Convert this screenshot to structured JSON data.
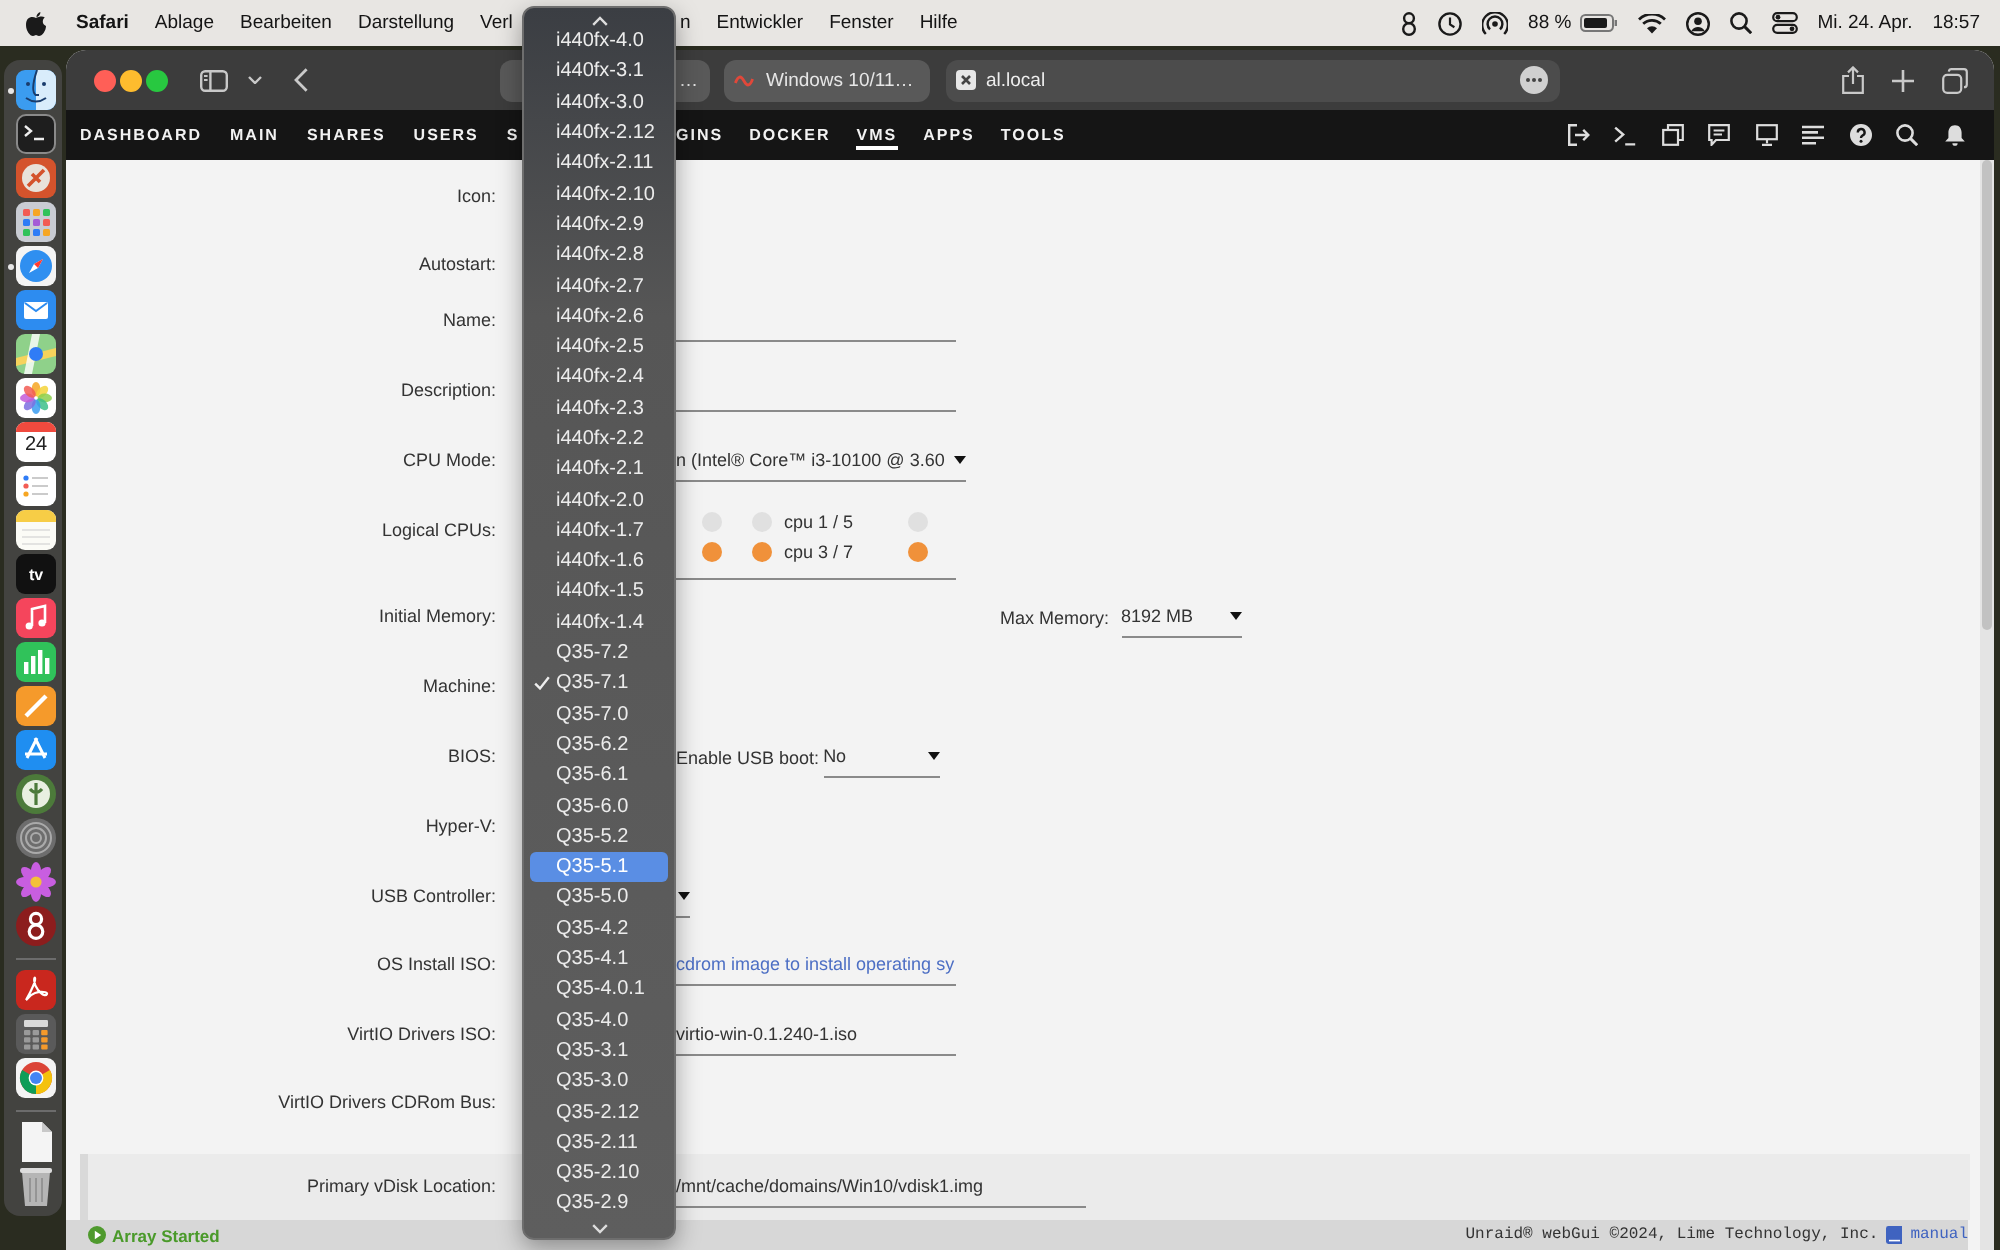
{
  "menu_bar": {
    "app_name": "Safari",
    "menus": [
      "Ablage",
      "Bearbeiten",
      "Darstellung",
      "Verl",
      "n",
      "Entwickler",
      "Fenster",
      "Hilfe"
    ],
    "battery_percent": "88 %",
    "date": "Mi. 24. Apr.",
    "time": "18:57"
  },
  "dock": {
    "items": [
      {
        "kind": "finder",
        "running": true
      },
      {
        "kind": "terminal",
        "running": false
      },
      {
        "kind": "disc",
        "running": false
      },
      {
        "kind": "launchpad",
        "running": false
      },
      {
        "kind": "safari",
        "running": true
      },
      {
        "kind": "mail",
        "running": false
      },
      {
        "kind": "maps",
        "running": false
      },
      {
        "kind": "photos",
        "running": false
      },
      {
        "kind": "calendar",
        "label": "24",
        "running": false
      },
      {
        "kind": "reminders",
        "running": false
      },
      {
        "kind": "notes",
        "running": false
      },
      {
        "kind": "tv",
        "label": "tv",
        "running": false
      },
      {
        "kind": "music",
        "running": false
      },
      {
        "kind": "numbers",
        "running": false
      },
      {
        "kind": "pen",
        "running": false
      },
      {
        "kind": "store",
        "running": false
      },
      {
        "kind": "leaf",
        "running": false
      },
      {
        "kind": "spiral",
        "running": false
      },
      {
        "kind": "daisy",
        "running": false
      },
      {
        "kind": "eight",
        "running": false
      },
      {
        "kind": "separator"
      },
      {
        "kind": "pdf",
        "running": false
      },
      {
        "kind": "calculator",
        "running": false
      },
      {
        "kind": "chrome",
        "running": false
      },
      {
        "kind": "separator"
      },
      {
        "kind": "document",
        "running": false
      },
      {
        "kind": "trash",
        "running": false
      }
    ]
  },
  "browser": {
    "tabs": [
      {
        "title": "…",
        "selected": false
      },
      {
        "title": "Windows 10/11…",
        "selected": false
      }
    ],
    "address": "al.local"
  },
  "nav": {
    "items": [
      {
        "label": "DASHBOARD",
        "selected": false
      },
      {
        "label": "MAIN",
        "selected": false
      },
      {
        "label": "SHARES",
        "selected": false
      },
      {
        "label": "USERS",
        "selected": false
      },
      {
        "label": "S",
        "selected": false
      },
      {
        "label": "GINS",
        "selected": false
      },
      {
        "label": "DOCKER",
        "selected": false
      },
      {
        "label": "VMS",
        "selected": true
      },
      {
        "label": "APPS",
        "selected": false
      },
      {
        "label": "TOOLS",
        "selected": false
      }
    ]
  },
  "form": {
    "rows": [
      {
        "label": "Icon:",
        "kind": "blank"
      },
      {
        "label": "Autostart:",
        "kind": "blank"
      },
      {
        "label": "Name:",
        "kind": "input"
      },
      {
        "label": "Description:",
        "kind": "input"
      },
      {
        "label": "CPU Mode:",
        "kind": "select",
        "value": "n (Intel® Core™ i3-10100 @ 3.60"
      },
      {
        "label": "Logical CPUs:",
        "kind": "cpus",
        "cpu_rows": [
          {
            "pins": [
              {
                "checked": false
              },
              {
                "checked": false,
                "label": "cpu 1 / 5"
              },
              {
                "checked": false
              }
            ]
          },
          {
            "pins": [
              {
                "checked": true
              },
              {
                "checked": true,
                "label": "cpu 3 / 7"
              },
              {
                "checked": true
              }
            ]
          }
        ]
      },
      {
        "label": "Initial Memory:",
        "kind": "memory",
        "side_field": {
          "label": "Max Memory:",
          "value": "8192 MB"
        }
      },
      {
        "label": "Machine:",
        "kind": "blank"
      },
      {
        "label": "BIOS:",
        "kind": "bios",
        "side_field": {
          "label": "Enable USB boot:",
          "value": "No"
        }
      },
      {
        "label": "Hyper-V:",
        "kind": "blank"
      },
      {
        "label": "USB Controller:",
        "kind": "select_tail"
      },
      {
        "label": "OS Install ISO:",
        "kind": "input",
        "placeholder": "cdrom image to install operating sy"
      },
      {
        "label": "VirtIO Drivers ISO:",
        "kind": "input",
        "value": "virtio-win-0.1.240-1.iso"
      },
      {
        "label": "VirtIO Drivers CDRom Bus:",
        "kind": "blank"
      }
    ],
    "disk": {
      "label": "Primary vDisk Location:",
      "value": "/mnt/cache/domains/Win10/vdisk1.img"
    }
  },
  "machine_menu": {
    "items": [
      {
        "label": "i440fx-4.0",
        "checked": false,
        "selected": false
      },
      {
        "label": "i440fx-3.1",
        "checked": false,
        "selected": false
      },
      {
        "label": "i440fx-3.0",
        "checked": false,
        "selected": false
      },
      {
        "label": "i440fx-2.12",
        "checked": false,
        "selected": false
      },
      {
        "label": "i440fx-2.11",
        "checked": false,
        "selected": false
      },
      {
        "label": "i440fx-2.10",
        "checked": false,
        "selected": false
      },
      {
        "label": "i440fx-2.9",
        "checked": false,
        "selected": false
      },
      {
        "label": "i440fx-2.8",
        "checked": false,
        "selected": false
      },
      {
        "label": "i440fx-2.7",
        "checked": false,
        "selected": false
      },
      {
        "label": "i440fx-2.6",
        "checked": false,
        "selected": false
      },
      {
        "label": "i440fx-2.5",
        "checked": false,
        "selected": false
      },
      {
        "label": "i440fx-2.4",
        "checked": false,
        "selected": false
      },
      {
        "label": "i440fx-2.3",
        "checked": false,
        "selected": false
      },
      {
        "label": "i440fx-2.2",
        "checked": false,
        "selected": false
      },
      {
        "label": "i440fx-2.1",
        "checked": false,
        "selected": false
      },
      {
        "label": "i440fx-2.0",
        "checked": false,
        "selected": false
      },
      {
        "label": "i440fx-1.7",
        "checked": false,
        "selected": false
      },
      {
        "label": "i440fx-1.6",
        "checked": false,
        "selected": false
      },
      {
        "label": "i440fx-1.5",
        "checked": false,
        "selected": false
      },
      {
        "label": "i440fx-1.4",
        "checked": false,
        "selected": false
      },
      {
        "label": "Q35-7.2",
        "checked": false,
        "selected": false
      },
      {
        "label": "Q35-7.1",
        "checked": true,
        "selected": false
      },
      {
        "label": "Q35-7.0",
        "checked": false,
        "selected": false
      },
      {
        "label": "Q35-6.2",
        "checked": false,
        "selected": false
      },
      {
        "label": "Q35-6.1",
        "checked": false,
        "selected": false
      },
      {
        "label": "Q35-6.0",
        "checked": false,
        "selected": false
      },
      {
        "label": "Q35-5.2",
        "checked": false,
        "selected": false
      },
      {
        "label": "Q35-5.1",
        "checked": false,
        "selected": true
      },
      {
        "label": "Q35-5.0",
        "checked": false,
        "selected": false
      },
      {
        "label": "Q35-4.2",
        "checked": false,
        "selected": false
      },
      {
        "label": "Q35-4.1",
        "checked": false,
        "selected": false
      },
      {
        "label": "Q35-4.0.1",
        "checked": false,
        "selected": false
      },
      {
        "label": "Q35-4.0",
        "checked": false,
        "selected": false
      },
      {
        "label": "Q35-3.1",
        "checked": false,
        "selected": false
      },
      {
        "label": "Q35-3.0",
        "checked": false,
        "selected": false
      },
      {
        "label": "Q35-2.12",
        "checked": false,
        "selected": false
      },
      {
        "label": "Q35-2.11",
        "checked": false,
        "selected": false
      },
      {
        "label": "Q35-2.10",
        "checked": false,
        "selected": false
      },
      {
        "label": "Q35-2.9",
        "checked": false,
        "selected": false
      }
    ]
  },
  "status_bar": {
    "status": "Array Started",
    "footer": "Unraid® webGui ©2024, Lime Technology, Inc.",
    "link": "manual"
  }
}
